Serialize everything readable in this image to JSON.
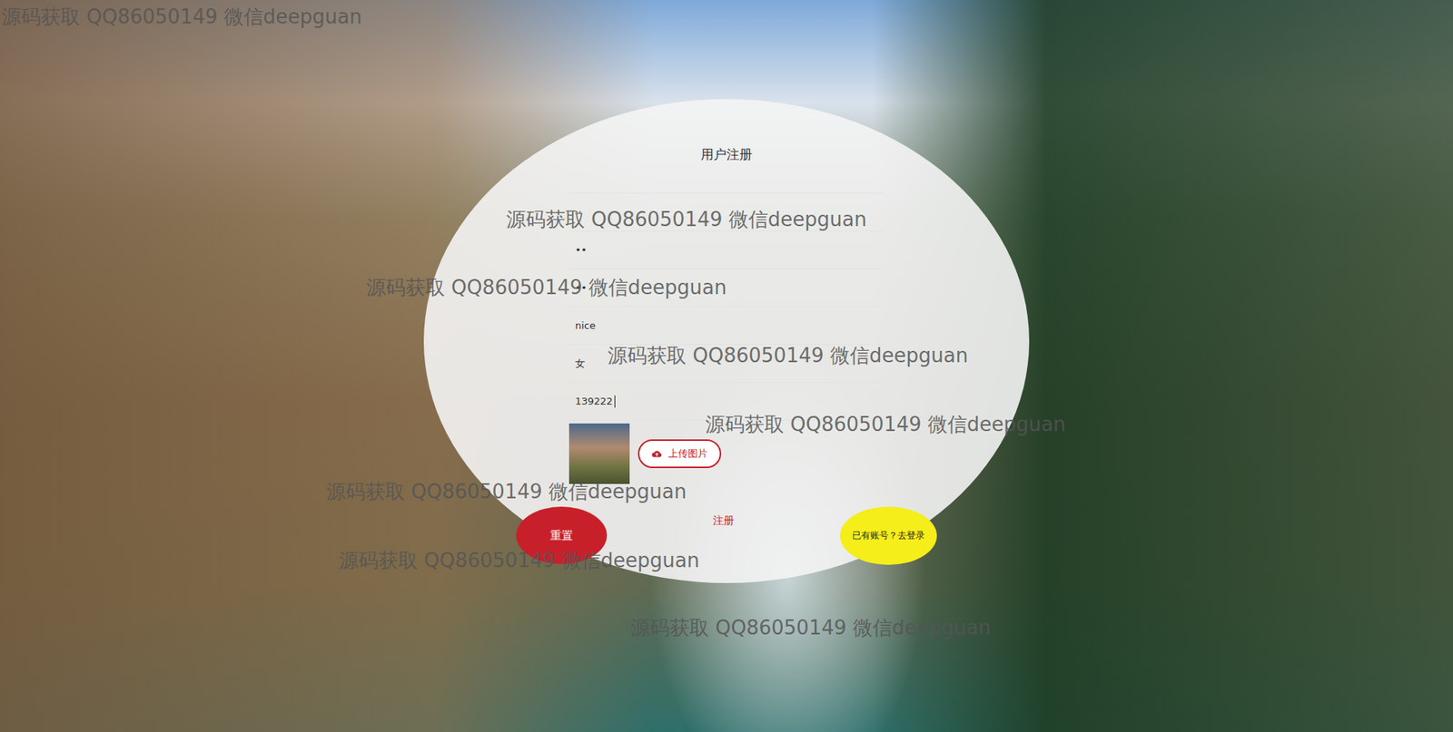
{
  "form": {
    "title": "用户注册",
    "fields": [
      {
        "value": "··",
        "focused": false
      },
      {
        "value": "••",
        "focused": false
      },
      {
        "value": "••",
        "focused": false
      },
      {
        "value": "nice",
        "focused": false
      },
      {
        "value": "女",
        "focused": false
      },
      {
        "value": "139222",
        "focused": true
      }
    ],
    "upload_button": "上传图片",
    "reset_button": "重置",
    "submit_button": "注册",
    "login_link": "已有账号？去登录"
  },
  "watermarks": [
    "源码获取 QQ86050149 微信deepguan",
    "源码获取 QQ86050149 微信deepguan",
    "源码获取 QQ86050149 微信deepguan",
    "源码获取 QQ86050149 微信deepguan",
    "源码获取 QQ86050149 微信deepguan",
    "源码获取 QQ86050149 微信deepguan",
    "源码获取 QQ86050149 微信deepguan",
    "源码获取 QQ86050149 微信deepguan"
  ]
}
